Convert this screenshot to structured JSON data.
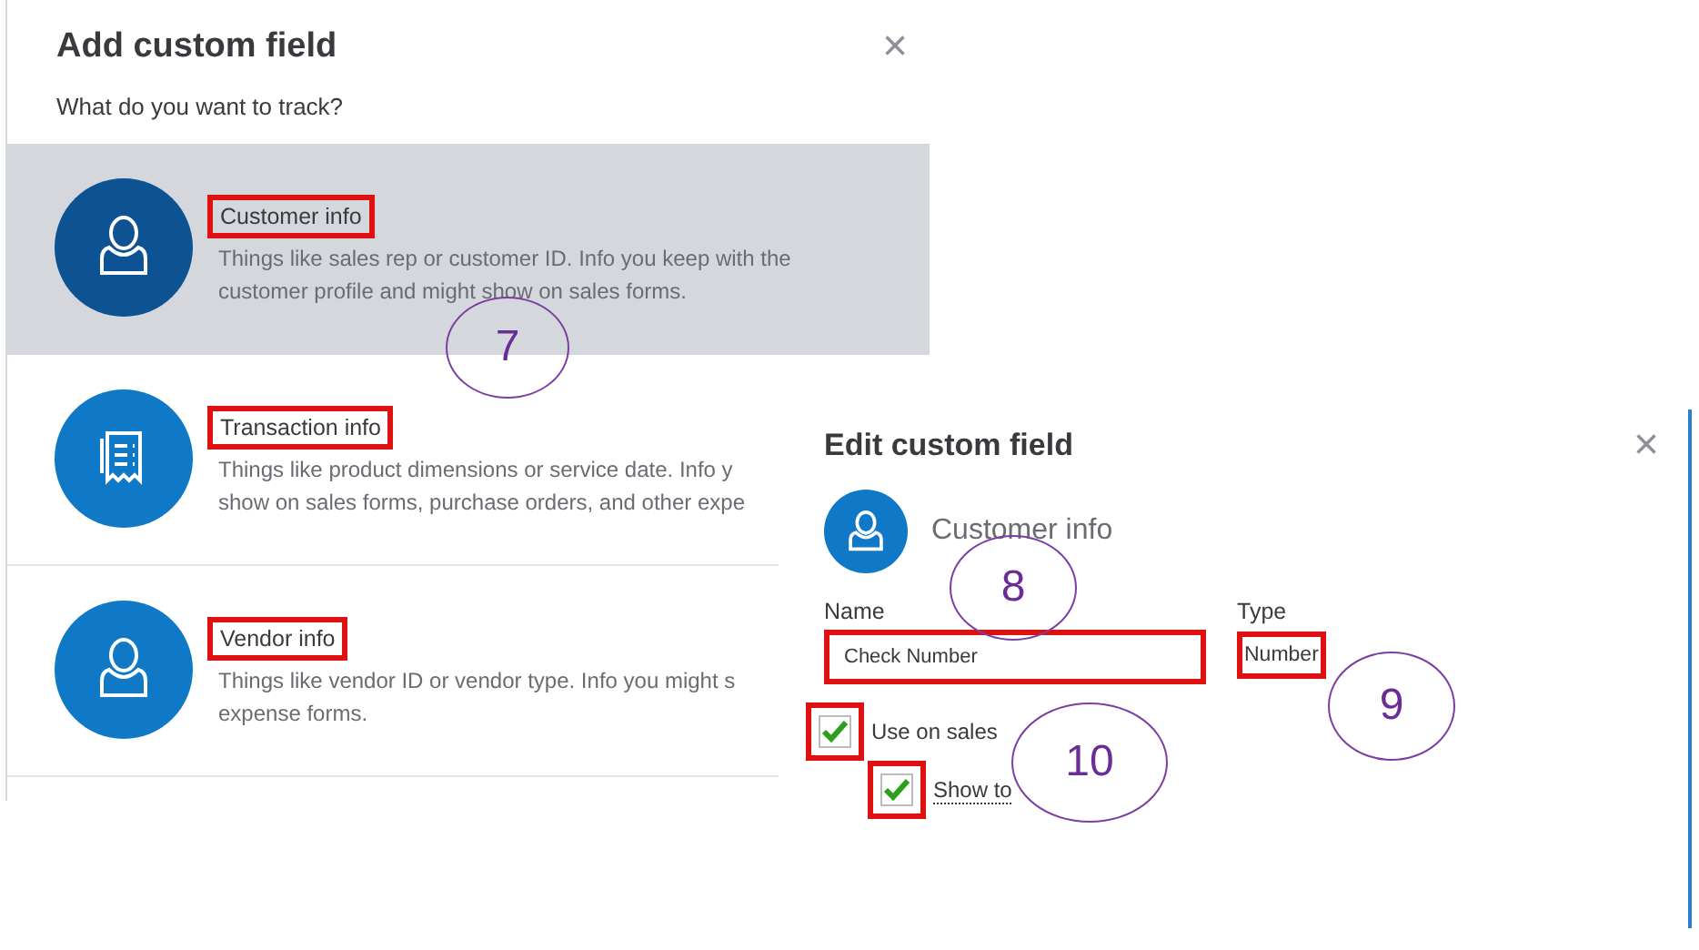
{
  "add_dialog": {
    "title": "Add custom field",
    "close": "×",
    "prompt": "What do you want to track?",
    "options": [
      {
        "kind": "person",
        "title": "Customer info",
        "lines": [
          "Things like sales rep or customer ID. Info you keep with the",
          "customer profile and might show on sales forms."
        ],
        "selected": true,
        "annotated": true
      },
      {
        "kind": "receipt",
        "title": "Transaction info",
        "lines": [
          "Things like product dimensions or service date. Info y",
          "show on sales forms, purchase orders, and other expe"
        ],
        "selected": false,
        "annotated": true
      },
      {
        "kind": "person",
        "title": "Vendor info",
        "lines": [
          "Things like vendor ID or vendor type. Info you might s",
          "expense forms."
        ],
        "selected": false,
        "annotated": true
      }
    ]
  },
  "edit_dialog": {
    "title": "Edit custom field",
    "close": "×",
    "category": "Customer info",
    "name_label": "Name",
    "name_value": "Check Number",
    "name_annotated": true,
    "type_label": "Type",
    "type_value": "Number",
    "type_annotated": true,
    "checkboxes": [
      {
        "label": "Use on sales",
        "checked": true,
        "annotated": true
      },
      {
        "label": "Show to",
        "checked": true,
        "annotated": true
      }
    ]
  },
  "callouts": [
    {
      "label": "7"
    },
    {
      "label": "8"
    },
    {
      "label": "9"
    },
    {
      "label": "10"
    }
  ]
}
